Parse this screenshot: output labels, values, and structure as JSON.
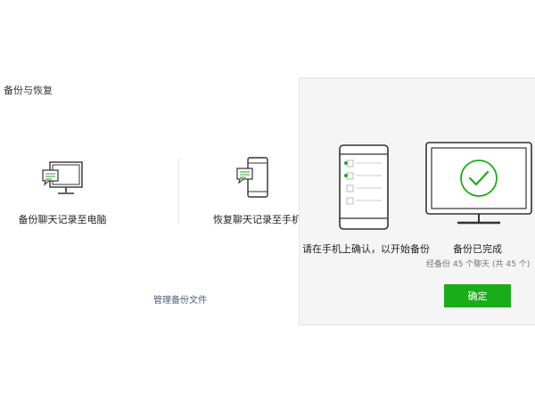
{
  "dialog": {
    "title": "备份与恢复",
    "backup_option_label": "备份聊天记录至电脑",
    "restore_option_label": "恢复聊天记录至手机",
    "manage_link": "管理备份文件"
  },
  "progress_panel": {
    "phone_prompt": "请在手机上确认，以开始备份",
    "done_title": "备份已完成",
    "done_detail": "经备份 45 个聊天 (共 45 个)",
    "confirm_button": "确定"
  },
  "colors": {
    "accent_green": "#1aad19",
    "icon_green": "#5bb85b",
    "panel_bg": "#f5f5f5",
    "link": "#4a6079"
  }
}
